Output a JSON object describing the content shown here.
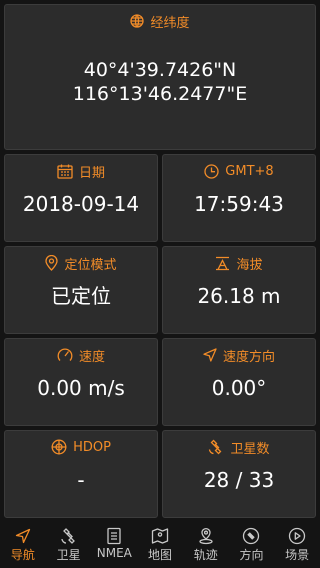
{
  "colors": {
    "accent": "#f28c28",
    "card": "#2c2c2c",
    "background": "#141414"
  },
  "coordinates": {
    "title": "经纬度",
    "icon": "globe-icon",
    "latitude": "40°4'39.7426\"N",
    "longitude": "116°13'46.2477\"E"
  },
  "cells": {
    "date": {
      "title": "日期",
      "icon": "calendar-icon",
      "value": "2018-09-14"
    },
    "time": {
      "title": "GMT+8",
      "icon": "clock-icon",
      "value": "17:59:43"
    },
    "fix_mode": {
      "title": "定位模式",
      "icon": "location-pin-icon",
      "value": "已定位"
    },
    "altitude": {
      "title": "海拔",
      "icon": "mountain-icon",
      "value": "26.18 m"
    },
    "speed": {
      "title": "速度",
      "icon": "speedometer-icon",
      "value": "0.00 m/s"
    },
    "heading": {
      "title": "速度方向",
      "icon": "direction-arrow-icon",
      "value": "0.00°"
    },
    "hdop": {
      "title": "HDOP",
      "icon": "crosshair-icon",
      "value": "-"
    },
    "satellites": {
      "title": "卫星数",
      "icon": "satellite-icon",
      "value": "28 / 33"
    }
  },
  "nav": {
    "items": [
      {
        "label": "导航",
        "icon": "navigation-arrow-icon",
        "active": true
      },
      {
        "label": "卫星",
        "icon": "satellite-icon",
        "active": false
      },
      {
        "label": "NMEA",
        "icon": "document-icon",
        "active": false
      },
      {
        "label": "地图",
        "icon": "map-icon",
        "active": false
      },
      {
        "label": "轨迹",
        "icon": "track-pin-icon",
        "active": false
      },
      {
        "label": "方向",
        "icon": "compass-icon",
        "active": false
      },
      {
        "label": "场景",
        "icon": "play-icon",
        "active": false
      }
    ]
  }
}
